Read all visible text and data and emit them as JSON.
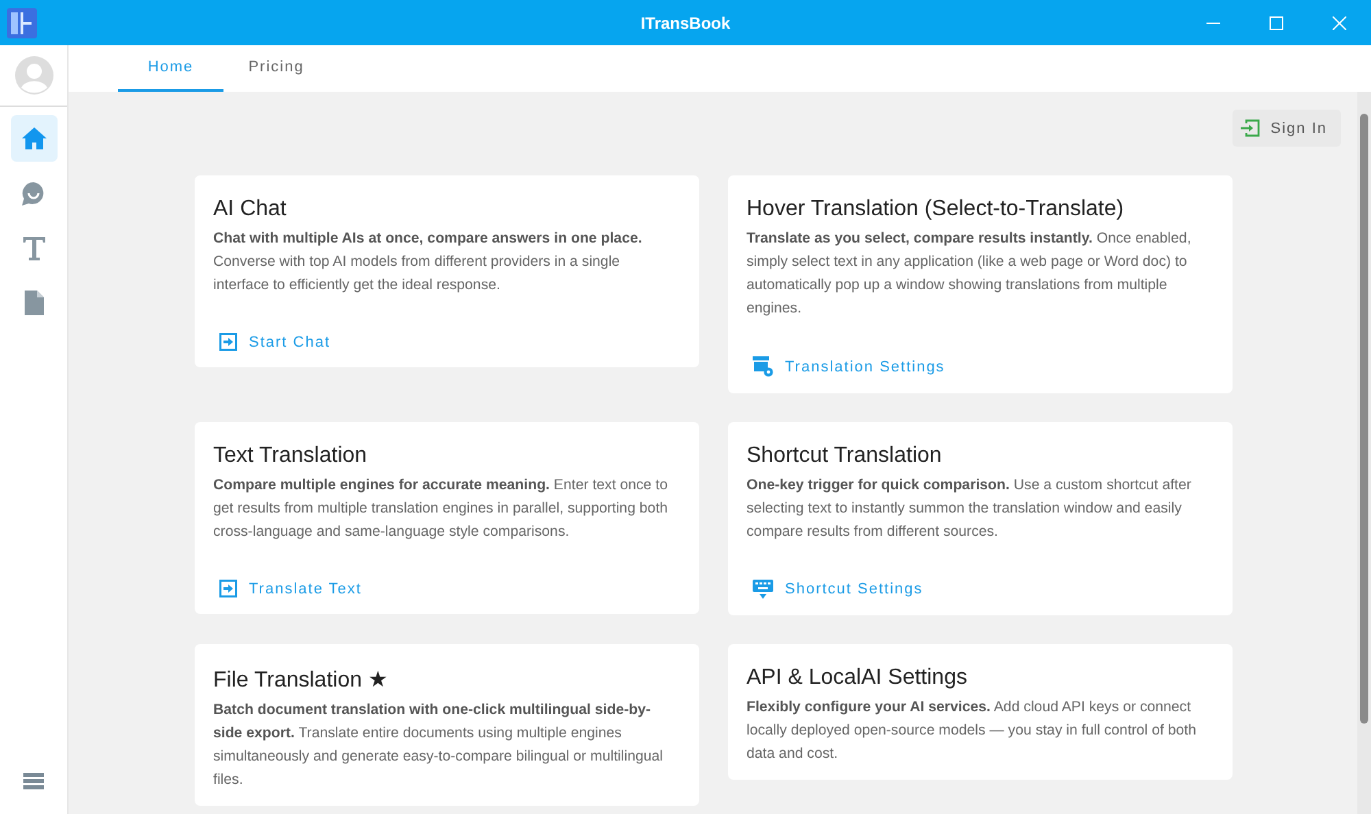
{
  "window": {
    "title": "ITransBook"
  },
  "tabs": [
    {
      "label": "Home",
      "selected": true
    },
    {
      "label": "Pricing",
      "selected": false
    }
  ],
  "sidebar": {
    "items": [
      {
        "kind": "home",
        "selected": true
      },
      {
        "kind": "chat",
        "selected": false
      },
      {
        "kind": "text",
        "selected": false
      },
      {
        "kind": "document",
        "selected": false
      }
    ]
  },
  "sign_in": {
    "label": "Sign In"
  },
  "cards": [
    {
      "title": "AI Chat",
      "description": "**Chat with multiple AIs at once, compare answers in one place.** Converse with top AI models from different providers in a single interface to efficiently get the ideal response.",
      "action": {
        "label": "Start Chat",
        "kind": "enter"
      }
    },
    {
      "title": "Hover Translation (Select-to-Translate)",
      "description": "**Translate as you select, compare results instantly.** Once enabled, simply select text in any application (like a web page or Word doc) to automatically pop up a window showing translations from multiple engines.",
      "action": {
        "label": "Translation Settings",
        "kind": "settings"
      }
    },
    {
      "title": "Text Translation",
      "description": "**Compare multiple engines for accurate meaning.** Enter text once to get results from multiple translation engines in parallel, supporting both cross-language and same-language style comparisons.",
      "action": {
        "label": "Translate Text",
        "kind": "enter"
      }
    },
    {
      "title": "Shortcut Translation",
      "description": "**One-key trigger for quick comparison.** Use a custom shortcut after selecting text to instantly summon the translation window and easily compare results from different sources.",
      "action": {
        "label": "Shortcut Settings",
        "kind": "keyboard"
      }
    },
    {
      "title": "File Translation ★",
      "description": "**Batch document translation with one-click multilingual side-by-side export.** Translate entire documents using multiple engines simultaneously and generate easy-to-compare bilingual or multilingual files."
    },
    {
      "title": "API & LocalAI Settings",
      "description": "**Flexibly configure your AI services.** Add cloud API keys or connect locally deployed open-source models — you stay in full control of both data and cost."
    }
  ]
}
